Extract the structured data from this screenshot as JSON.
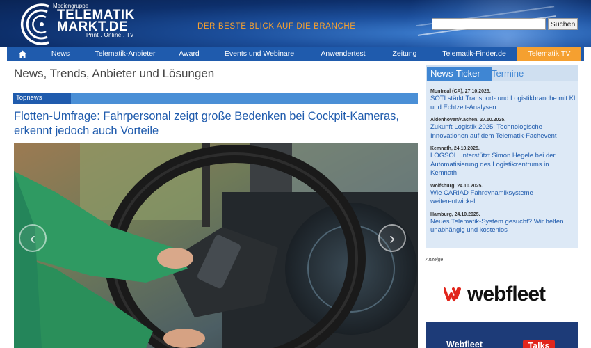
{
  "header": {
    "logo": {
      "group_label": "Mediengruppe",
      "line1": "TELEMATIK",
      "line2": "MARKT.DE",
      "sub": "Print . Online . TV"
    },
    "slogan": "DER BESTE BLICK AUF DIE BRANCHE",
    "search": {
      "placeholder": "",
      "button_label": "Suchen"
    }
  },
  "nav": {
    "home_icon": "home-icon",
    "items": [
      {
        "label": "News"
      },
      {
        "label": "Telematik-Anbieter"
      },
      {
        "label": "Award"
      },
      {
        "label": "Events und Webinare"
      },
      {
        "label": "Anwendertest"
      },
      {
        "label": "Zeitung"
      },
      {
        "label": "Telematik-Finder.de"
      },
      {
        "label": "Telematik.TV",
        "active": true
      }
    ]
  },
  "main": {
    "heading": "News, Trends, Anbieter und Lösungen",
    "topnews_label": "Topnews",
    "article_title": "Flotten-Umfrage: Fahrpersonal zeigt große Bedenken bei Cockpit-Kameras, erkennt jedoch auch Vorteile",
    "slider": {
      "prev_icon": "chevron-left-icon",
      "next_icon": "chevron-right-icon",
      "prev_glyph": "‹",
      "next_glyph": "›"
    }
  },
  "sidebar": {
    "tabs": {
      "active": "News-Ticker",
      "inactive": "Termine"
    },
    "ticker": [
      {
        "meta": "Montreal (CA), 27.10.2025.",
        "text": "SOTI stärkt Transport- und Logistikbranche mit KI und Echtzeit-Analysen"
      },
      {
        "meta": "Aldenhoven/Aachen, 27.10.2025.",
        "text": "Zukunft Logistik 2025: Technologische Innovationen auf dem Telematik-Fachevent"
      },
      {
        "meta": "Kemnath, 24.10.2025.",
        "text": "LOGSOL unterstützt Simon Hegele bei der Automatisierung des Logistikzentrums in Kemnath"
      },
      {
        "meta": "Wolfsburg, 24.10.2025.",
        "text": "Wie CARIAD Fahrdynamiksysteme weiterentwickelt"
      },
      {
        "meta": "Hamburg, 24.10.2025.",
        "text": "Neues Telematik-System gesucht? Wir helfen unabhängig und kostenlos"
      }
    ],
    "ad_label": "Anzeige",
    "ad_brand": "webfleet",
    "banner": {
      "text": "Webfleet",
      "badge": "Talks"
    }
  },
  "colors": {
    "primary_blue": "#1f5bad",
    "accent_orange": "#f5a030",
    "ticker_bg": "#dde9f6",
    "webfleet_red": "#e1261c"
  }
}
